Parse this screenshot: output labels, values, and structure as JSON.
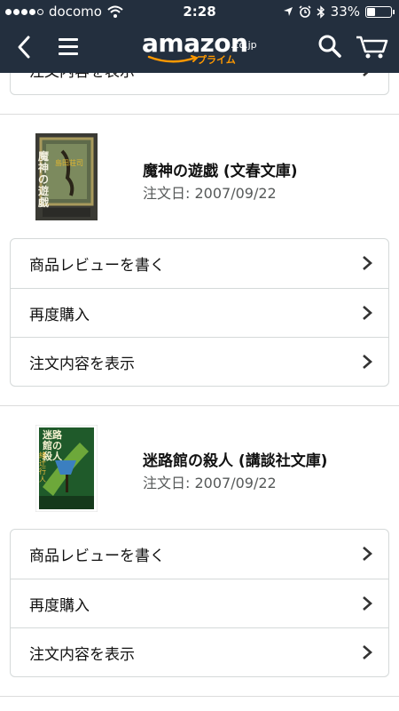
{
  "status_bar": {
    "carrier": "docomo",
    "time": "2:28",
    "battery": "33%",
    "battery_level": 0.33,
    "icons": [
      "signal-dots",
      "wifi-icon",
      "location-arrow-icon",
      "alarm-icon",
      "bluetooth-icon",
      "battery-icon"
    ]
  },
  "header": {
    "logo_text": "amazon",
    "logo_suffix": ".co.jp",
    "logo_prime": "プライム",
    "colors": {
      "background": "#232f3e",
      "accent": "#ff9900"
    }
  },
  "partial_row": {
    "label": "注文内容を表示"
  },
  "orders": [
    {
      "title": "魔神の遊戯 (文春文庫)",
      "order_date": "注文日: 2007/09/22",
      "cover_text": "魔神の遊戯",
      "cover_author": "島田荘司",
      "actions": [
        {
          "label": "商品レビューを書く"
        },
        {
          "label": "再度購入"
        },
        {
          "label": "注文内容を表示"
        }
      ]
    },
    {
      "title": "迷路館の殺人 (講談社文庫)",
      "order_date": "注文日: 2007/09/22",
      "cover_text": "迷路館の殺人",
      "cover_author": "綾辻行人",
      "actions": [
        {
          "label": "商品レビューを書く"
        },
        {
          "label": "再度購入"
        },
        {
          "label": "注文内容を表示"
        }
      ]
    }
  ]
}
